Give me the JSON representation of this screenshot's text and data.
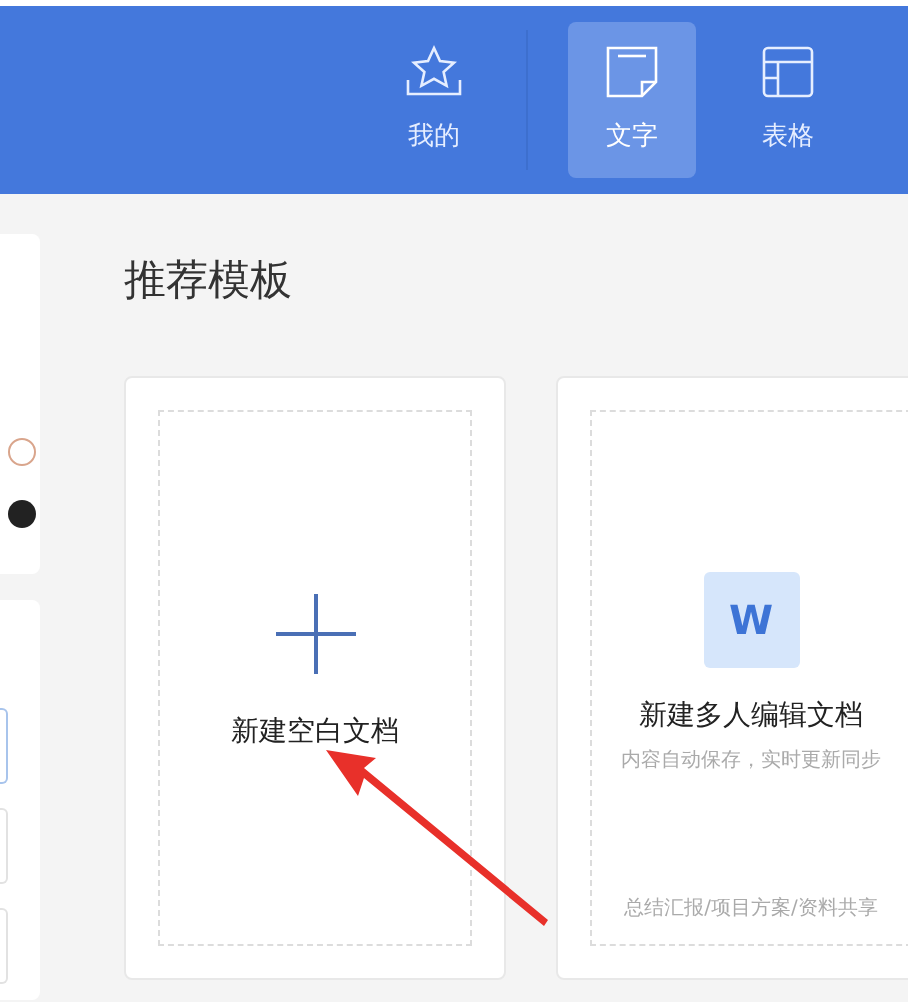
{
  "header": {
    "tabs": [
      {
        "label": "我的",
        "kind": "star",
        "selected": false
      },
      {
        "label": "文字",
        "kind": "note",
        "selected": true
      },
      {
        "label": "表格",
        "kind": "table",
        "selected": false
      }
    ]
  },
  "main": {
    "title": "推荐模板",
    "cards": [
      {
        "kind": "blank",
        "title": "新建空白文档"
      },
      {
        "kind": "collab",
        "badge": "W",
        "title": "新建多人编辑文档",
        "subtitle": "内容自动保存，实时更新同步",
        "footer": "总结汇报/项目方案/资料共享"
      }
    ]
  }
}
